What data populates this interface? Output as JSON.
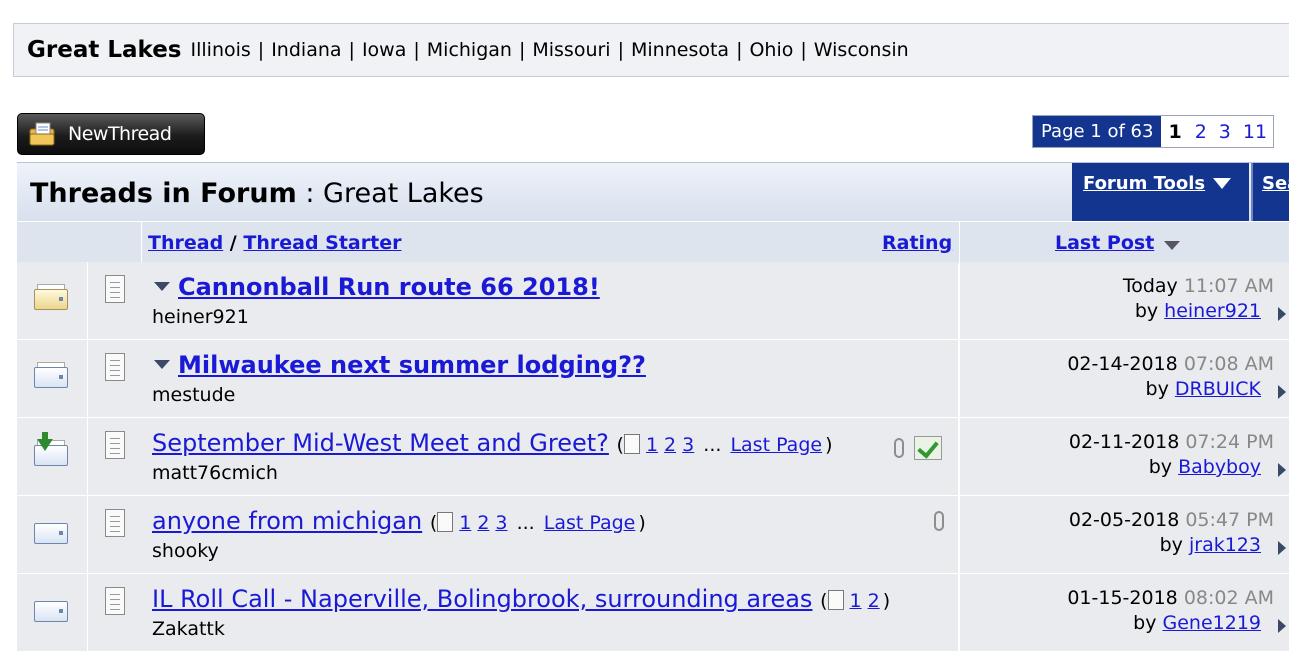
{
  "subforums": {
    "region": "Great Lakes",
    "states": [
      "Illinois",
      "Indiana",
      "Iowa",
      "Michigan",
      "Missouri",
      "Minnesota",
      "Ohio",
      "Wisconsin"
    ],
    "separator": "|"
  },
  "toolbar": {
    "new_thread_label": "NewThread"
  },
  "pagination": {
    "info": "Page 1 of 63",
    "current": "1",
    "pages": [
      "2",
      "3",
      "11"
    ]
  },
  "header": {
    "title_bold": "Threads in Forum",
    "title_sep": ":",
    "forum_name": "Great Lakes",
    "forum_tools": "Forum Tools",
    "search": "Search"
  },
  "columns": {
    "thread": "Thread",
    "slash": "/",
    "thread_starter": "Thread Starter",
    "rating": "Rating",
    "last_post": "Last Post"
  },
  "threads": [
    {
      "title": "Cannonball Run route 66 2018!",
      "starter": "heiner921",
      "date": "Today",
      "time": "11:07 AM",
      "by_label": "by",
      "last_poster": "heiner921",
      "status_icon": "envelope-new-yellow-icon"
    },
    {
      "title": "Milwaukee next summer lodging??",
      "starter": "mestude",
      "date": "02-14-2018",
      "time": "07:08 AM",
      "by_label": "by",
      "last_poster": "DRBUICK",
      "status_icon": "envelope-new-blue-icon"
    },
    {
      "title": "September Mid-West Meet and Greet?",
      "starter": "matt76cmich",
      "pages": [
        "1",
        "2",
        "3"
      ],
      "ellipsis": "...",
      "last_page": "Last Page",
      "date": "02-11-2018",
      "time": "07:24 PM",
      "by_label": "by",
      "last_poster": "Babyboy",
      "status_icon": "envelope-download-icon"
    },
    {
      "title": "anyone from michigan",
      "starter": "shooky",
      "pages": [
        "1",
        "2",
        "3"
      ],
      "ellipsis": "...",
      "last_page": "Last Page",
      "date": "02-05-2018",
      "time": "05:47 PM",
      "by_label": "by",
      "last_poster": "jrak123",
      "status_icon": "envelope-icon"
    },
    {
      "title": "IL Roll Call - Naperville, Bolingbrook, surrounding areas",
      "starter": "Zakattk",
      "pages": [
        "1",
        "2"
      ],
      "date": "01-15-2018",
      "time": "08:02 AM",
      "by_label": "by",
      "last_poster": "Gene1219",
      "status_icon": "envelope-icon"
    }
  ],
  "colors": {
    "header_blue": "#13348f",
    "link": "#1a1ad6",
    "row_bg": "#e9ebef",
    "time_gray": "#888888"
  }
}
